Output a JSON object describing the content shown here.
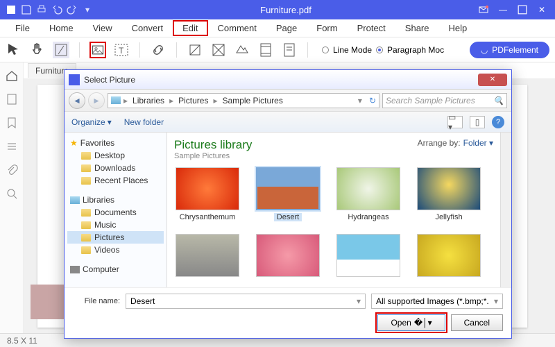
{
  "titlebar": {
    "title": "Furniture.pdf"
  },
  "menu": {
    "items": [
      "File",
      "Home",
      "View",
      "Convert",
      "Edit",
      "Comment",
      "Page",
      "Form",
      "Protect",
      "Share",
      "Help"
    ],
    "highlighted": "Edit"
  },
  "toolbar": {
    "mode_line": "Line Mode",
    "mode_para": "Paragraph Moc",
    "brand": "PDFelement"
  },
  "tab": {
    "label": "Furniture"
  },
  "status": {
    "dims": "8.5 X 11"
  },
  "dialog": {
    "title": "Select Picture",
    "breadcrumb": [
      "Libraries",
      "Pictures",
      "Sample Pictures"
    ],
    "search_placeholder": "Search Sample Pictures",
    "organize": "Organize",
    "newfolder": "New folder",
    "tree": {
      "favorites": {
        "head": "Favorites",
        "items": [
          "Desktop",
          "Downloads",
          "Recent Places"
        ]
      },
      "libraries": {
        "head": "Libraries",
        "items": [
          "Documents",
          "Music",
          "Pictures",
          "Videos"
        ],
        "selected": "Pictures"
      },
      "computer": {
        "head": "Computer"
      }
    },
    "content": {
      "title": "Pictures library",
      "subtitle": "Sample Pictures",
      "arrange_label": "Arrange by:",
      "arrange_value": "Folder",
      "thumbs": [
        "Chrysanthemum",
        "Desert",
        "Hydrangeas",
        "Jellyfish"
      ],
      "selected": "Desert"
    },
    "footer": {
      "filename_label": "File name:",
      "filename_value": "Desert",
      "filter": "All supported Images (*.bmp;*.",
      "open": "Open",
      "cancel": "Cancel"
    }
  }
}
